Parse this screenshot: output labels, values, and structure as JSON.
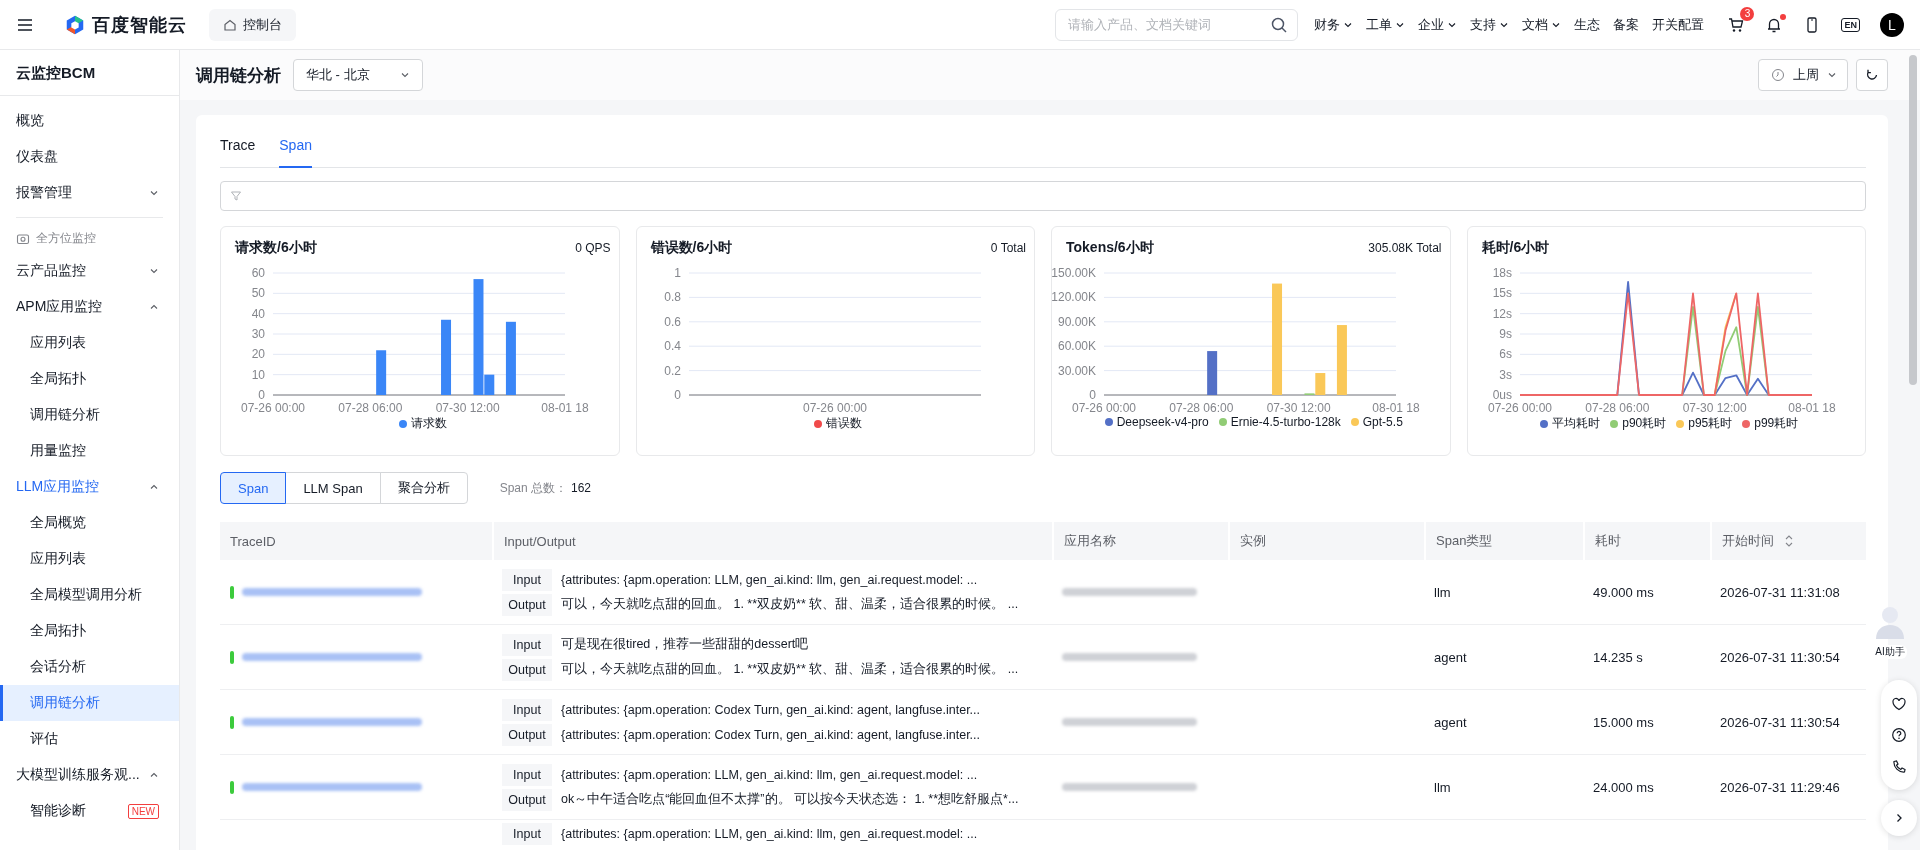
{
  "top_bar": {
    "brand": "百度智能云",
    "console_button": "控制台",
    "search": {
      "placeholder": "请输入产品、文档关键词"
    },
    "nav": [
      {
        "label": "财务",
        "dropdown": true
      },
      {
        "label": "工单",
        "dropdown": true
      },
      {
        "label": "企业",
        "dropdown": true
      },
      {
        "label": "支持",
        "dropdown": true
      },
      {
        "label": "文档",
        "dropdown": true
      },
      {
        "label": "生态",
        "dropdown": false
      },
      {
        "label": "备案",
        "dropdown": false
      },
      {
        "label": "开关配置",
        "dropdown": false
      }
    ],
    "cart_badge": "3",
    "notification_dot": true,
    "language": "EN",
    "avatar": "L"
  },
  "sidebar": {
    "title": "云监控BCM",
    "items": [
      {
        "kind": "link",
        "label": "概览",
        "selected": false
      },
      {
        "kind": "link",
        "label": "仪表盘",
        "selected": false
      },
      {
        "kind": "group",
        "label": "报警管理",
        "expanded": false,
        "selected": false
      },
      {
        "kind": "section",
        "label": "全方位监控"
      },
      {
        "kind": "group",
        "label": "云产品监控",
        "expanded": false,
        "selected": false
      },
      {
        "kind": "group",
        "label": "APM应用监控",
        "expanded": true,
        "selected": false,
        "children": [
          {
            "label": "应用列表",
            "selected": false
          },
          {
            "label": "全局拓扑",
            "selected": false
          },
          {
            "label": "调用链分析",
            "selected": false
          },
          {
            "label": "用量监控",
            "selected": false
          }
        ]
      },
      {
        "kind": "group",
        "label": "LLM应用监控",
        "expanded": true,
        "selected": false,
        "children": [
          {
            "label": "全局概览",
            "selected": false
          },
          {
            "label": "应用列表",
            "selected": false
          },
          {
            "label": "全局模型调用分析",
            "selected": false
          },
          {
            "label": "全局拓扑",
            "selected": false
          },
          {
            "label": "会话分析",
            "selected": false
          },
          {
            "label": "调用链分析",
            "selected": true
          },
          {
            "label": "评估",
            "selected": false
          }
        ]
      },
      {
        "kind": "group",
        "label": "大模型训练服务观...",
        "expanded": true,
        "selected": false,
        "children": [
          {
            "label": "智能诊断",
            "selected": false,
            "badge": "NEW"
          }
        ]
      }
    ]
  },
  "page": {
    "title": "调用链分析",
    "region": "华北 - 北京",
    "time_range": "上周"
  },
  "tabs": [
    {
      "label": "Trace",
      "selected": false
    },
    {
      "label": "Span",
      "selected": true
    }
  ],
  "charts": [
    {
      "title": "请求数/6小时",
      "summary": "0 QPS",
      "chart_data": {
        "type": "bar",
        "grid": true,
        "ylim": [
          0,
          60
        ],
        "categories": [
          "07-26 00:00",
          null,
          null,
          null,
          null,
          null,
          null,
          null,
          null,
          "07-28 06:00",
          null,
          null,
          null,
          null,
          null,
          null,
          null,
          null,
          "07-30 12:00",
          null,
          null,
          null,
          null,
          null,
          null,
          null,
          null,
          "08-01 18"
        ],
        "yticks": [
          {
            "value": 0,
            "label": "0"
          },
          {
            "value": 10,
            "label": "10"
          },
          {
            "value": 20,
            "label": "20"
          },
          {
            "value": 30,
            "label": "30"
          },
          {
            "value": 40,
            "label": "40"
          },
          {
            "value": 50,
            "label": "50"
          },
          {
            "value": 60,
            "label": "60"
          }
        ],
        "series": [
          {
            "name": "请求数",
            "color": "#3a86f7",
            "values": [
              0,
              0,
              0,
              0,
              0,
              0,
              0,
              0,
              0,
              0,
              22,
              0,
              0,
              0,
              0,
              0,
              37,
              0,
              0,
              57,
              10,
              0,
              36,
              0,
              0,
              0,
              0,
              0
            ]
          }
        ]
      }
    },
    {
      "title": "错误数/6小时",
      "summary": "0 Total",
      "chart_data": {
        "type": "line",
        "grid": true,
        "categories": [
          "07-26 00:00"
        ],
        "ylim": [
          0,
          1
        ],
        "yticks": [
          {
            "value": 0,
            "label": "0"
          },
          {
            "value": 0.2,
            "label": "0.2"
          },
          {
            "value": 0.4,
            "label": "0.4"
          },
          {
            "value": 0.6,
            "label": "0.6"
          },
          {
            "value": 0.8,
            "label": "0.8"
          },
          {
            "value": 1,
            "label": "1"
          }
        ],
        "series": [
          {
            "name": "错误数",
            "color": "#f04a4a",
            "values": [
              null
            ]
          }
        ]
      }
    },
    {
      "title": "Tokens/6小时",
      "summary": "305.08K Total",
      "chart_data": {
        "type": "bar",
        "grid": true,
        "ylim": [
          0,
          150000
        ],
        "categories": [
          "07-26 00:00",
          null,
          null,
          null,
          null,
          null,
          null,
          null,
          null,
          "07-28 06:00",
          null,
          null,
          null,
          null,
          null,
          null,
          null,
          null,
          "07-30 12:00",
          null,
          null,
          null,
          null,
          null,
          null,
          null,
          null,
          "08-01 18"
        ],
        "yticks": [
          {
            "value": 0,
            "label": "0"
          },
          {
            "value": 30000,
            "label": "30.00K"
          },
          {
            "value": 60000,
            "label": "60.00K"
          },
          {
            "value": 90000,
            "label": "90.00K"
          },
          {
            "value": 120000,
            "label": "120.00K"
          },
          {
            "value": 150000,
            "label": "150.00K"
          }
        ],
        "series": [
          {
            "name": "Deepseek-v4-pro",
            "color": "#5470c6",
            "values": [
              null,
              null,
              null,
              null,
              null,
              null,
              null,
              null,
              null,
              null,
              54000,
              null,
              null,
              null,
              null,
              null,
              null,
              null,
              null,
              null,
              null,
              null,
              null,
              null,
              null,
              null,
              null,
              null
            ]
          },
          {
            "name": "Ernie-4.5-turbo-128k",
            "color": "#91cc75",
            "values": [
              null,
              null,
              null,
              null,
              null,
              null,
              null,
              null,
              null,
              null,
              null,
              null,
              null,
              null,
              null,
              null,
              null,
              null,
              null,
              2000,
              null,
              null,
              null,
              null,
              null,
              null,
              null,
              null
            ]
          },
          {
            "name": "Gpt-5.5",
            "color": "#fac858",
            "values": [
              null,
              null,
              null,
              null,
              null,
              null,
              null,
              null,
              null,
              null,
              null,
              null,
              null,
              null,
              null,
              null,
              137000,
              null,
              null,
              null,
              27000,
              null,
              86000,
              null,
              null,
              null,
              null,
              null
            ]
          }
        ]
      }
    },
    {
      "title": "耗时/6小时",
      "chart_data": {
        "type": "line",
        "grid": true,
        "ylim": [
          0,
          18
        ],
        "categories": [
          "07-26 00:00",
          null,
          null,
          null,
          null,
          null,
          null,
          null,
          null,
          "07-28 06:00",
          null,
          null,
          null,
          null,
          null,
          null,
          null,
          null,
          "07-30 12:00",
          null,
          null,
          null,
          null,
          null,
          null,
          null,
          null,
          "08-01 18"
        ],
        "yticks": [
          {
            "value": 0,
            "label": "0us"
          },
          {
            "value": 3,
            "label": "3s"
          },
          {
            "value": 6,
            "label": "6s"
          },
          {
            "value": 9,
            "label": "9s"
          },
          {
            "value": 12,
            "label": "12s"
          },
          {
            "value": 15,
            "label": "15s"
          },
          {
            "value": 18,
            "label": "18s"
          }
        ],
        "series": [
          {
            "name": "平均耗时",
            "color": "#5470c6",
            "values": [
              null,
              null,
              null,
              null,
              null,
              null,
              null,
              null,
              null,
              0,
              16.7,
              0,
              null,
              null,
              null,
              0,
              3.3,
              0,
              0,
              2.5,
              2.9,
              0,
              2.4,
              0,
              null,
              null,
              null,
              null
            ]
          },
          {
            "name": "p90耗时",
            "color": "#91cc75",
            "values": [
              null,
              null,
              null,
              null,
              null,
              null,
              null,
              null,
              null,
              null,
              null,
              null,
              null,
              null,
              null,
              0,
              13,
              0,
              0,
              6.5,
              10,
              0,
              13,
              0,
              null,
              null,
              null,
              null
            ]
          },
          {
            "name": "p95耗时",
            "color": "#fac858",
            "values": [
              null,
              null,
              null,
              null,
              null,
              null,
              null,
              null,
              null,
              null,
              null,
              null,
              null,
              null,
              null,
              null,
              null,
              null,
              0,
              10,
              15,
              null,
              null,
              null,
              null,
              null,
              null,
              null
            ]
          },
          {
            "name": "p99耗时",
            "color": "#ee6666",
            "values": [
              0,
              0,
              0,
              0,
              0,
              0,
              0,
              0,
              0,
              0,
              15,
              0,
              0,
              0,
              0,
              0,
              15,
              0,
              0,
              9.5,
              15,
              0,
              15,
              0,
              0,
              0,
              0,
              0
            ]
          }
        ]
      }
    }
  ],
  "view_buttons": [
    {
      "label": "Span",
      "selected": true
    },
    {
      "label": "LLM Span",
      "selected": false
    },
    {
      "label": "聚合分析",
      "selected": false
    }
  ],
  "span_total": {
    "label": "Span 总数：",
    "value": "162"
  },
  "table": {
    "columns": [
      {
        "label": "TraceID",
        "sortable": false
      },
      {
        "label": "Input/Output",
        "sortable": false
      },
      {
        "label": "应用名称",
        "sortable": false
      },
      {
        "label": "实例",
        "sortable": false
      },
      {
        "label": "Span类型",
        "sortable": false
      },
      {
        "label": "耗时",
        "sortable": false
      },
      {
        "label": "开始时间",
        "sortable": true
      }
    ],
    "rows": [
      {
        "input_label": "Input",
        "input": "{attributes: {apm.operation: LLM, gen_ai.kind: llm, gen_ai.request.model: ...",
        "output_label": "Output",
        "output": "可以，今天就吃点甜的回血。 1. **双皮奶** 软、甜、温柔，适合很累的时候。 ...",
        "span_type": "llm",
        "duration": "49.000 ms",
        "start_time": "2026-07-31 11:31:08"
      },
      {
        "input_label": "Input",
        "input": "可是现在很tired，推荐一些甜甜的dessert吧",
        "output_label": "Output",
        "output": "可以，今天就吃点甜的回血。 1. **双皮奶** 软、甜、温柔，适合很累的时候。 ...",
        "span_type": "agent",
        "duration": "14.235 s",
        "start_time": "2026-07-31 11:30:54"
      },
      {
        "input_label": "Input",
        "input": "{attributes: {apm.operation: Codex Turn, gen_ai.kind: agent, langfuse.inter...",
        "output_label": "Output",
        "output": "{attributes: {apm.operation: Codex Turn, gen_ai.kind: agent, langfuse.inter...",
        "span_type": "agent",
        "duration": "15.000 ms",
        "start_time": "2026-07-31 11:30:54"
      },
      {
        "input_label": "Input",
        "input": "{attributes: {apm.operation: LLM, gen_ai.kind: llm, gen_ai.request.model: ...",
        "output_label": "Output",
        "output": "ok～中午适合吃点“能回血但不太撑”的。 可以按今天状态选： 1. **想吃舒服点*...",
        "span_type": "llm",
        "duration": "24.000 ms",
        "start_time": "2026-07-31 11:29:46"
      },
      {
        "input_label": "Input",
        "input": "{attributes: {apm.operation: LLM, gen_ai.kind: llm, gen_ai.request.model: ..."
      }
    ]
  },
  "assistant": {
    "label": "AI助手"
  }
}
